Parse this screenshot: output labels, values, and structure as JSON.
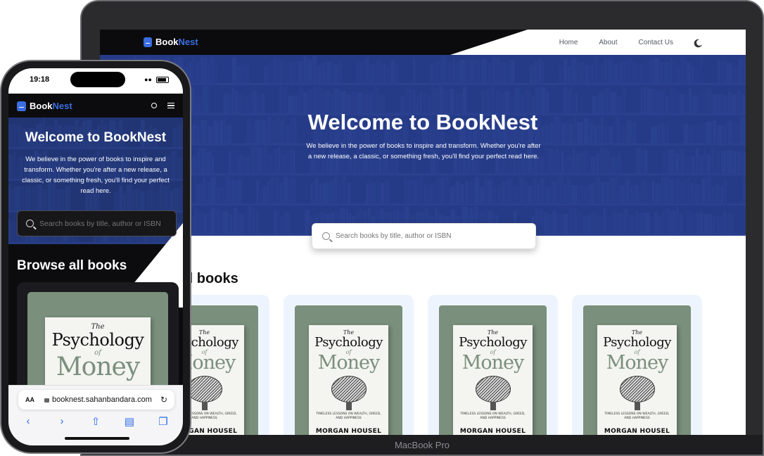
{
  "brand": {
    "name_a": "Book",
    "name_b": "Nest",
    "accent_color": "#3b6de0"
  },
  "laptop": {
    "nav": {
      "home": "Home",
      "about": "About",
      "contact": "Contact Us",
      "theme_icon": "moon-icon"
    },
    "hero": {
      "title": "Welcome to BookNest",
      "subtitle": "We believe in the power of books to inspire and transform. Whether you're after a new release, a classic, or something fresh, you'll find your perfect read here."
    },
    "search": {
      "placeholder": "Search books by title, author or ISBN"
    },
    "browse_title": "all books",
    "chin_label": "MacBook Pro",
    "books": [
      {
        "the": "The",
        "title": "Psychology",
        "of": "of",
        "money": "Money",
        "tagline": "TIMELESS LESSONS ON WEALTH, GREED, AND HAPPINESS",
        "author": "MORGAN HOUSEL"
      },
      {
        "the": "The",
        "title": "Psychology",
        "of": "of",
        "money": "Money",
        "tagline": "TIMELESS LESSONS ON WEALTH, GREED, AND HAPPINESS",
        "author": "MORGAN HOUSEL"
      },
      {
        "the": "The",
        "title": "Psychology",
        "of": "of",
        "money": "Money",
        "tagline": "TIMELESS LESSONS ON WEALTH, GREED, AND HAPPINESS",
        "author": "MORGAN HOUSEL"
      },
      {
        "the": "The",
        "title": "Psychology",
        "of": "of",
        "money": "Money",
        "tagline": "TIMELESS LESSONS ON WEALTH, GREED, AND HAPPINESS",
        "author": "MORGAN HOUSEL"
      }
    ]
  },
  "phone": {
    "status_time": "19:18",
    "hero": {
      "title": "Welcome to BookNest",
      "subtitle": "We believe in the power of books to inspire and transform. Whether you're after a new release, a classic, or something fresh, you'll find your perfect read here."
    },
    "search": {
      "placeholder": "Search books by title, author or ISBN"
    },
    "browse_title": "Browse all books",
    "book": {
      "the": "The",
      "title": "Psychology",
      "of": "of",
      "money": "Money"
    },
    "browser": {
      "aa": "AA",
      "url": "booknest.sahanbandara.com"
    }
  }
}
